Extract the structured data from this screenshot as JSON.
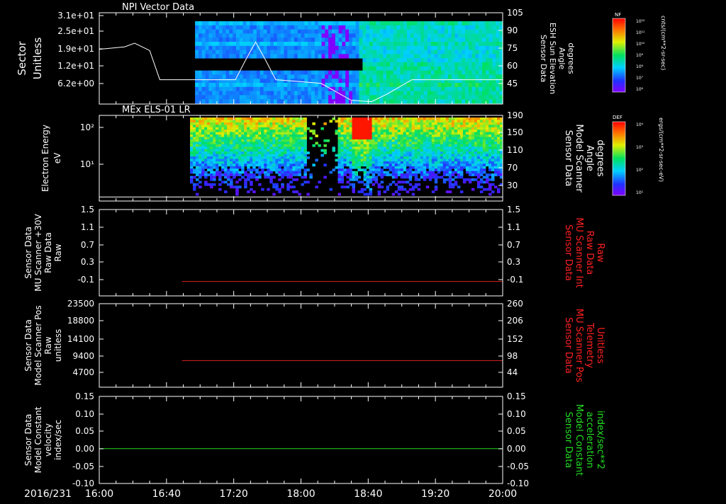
{
  "time_axis": {
    "date": "2016/231",
    "ticks": [
      "16:00",
      "16:40",
      "17:20",
      "18:00",
      "18:40",
      "19:20",
      "20:00"
    ],
    "range_hours": [
      16,
      20
    ]
  },
  "colorbars": [
    {
      "tag": "NF",
      "unit": "cnts/(cm**2-sr-sec)",
      "tick_labels": [
        "10¹²",
        "10¹¹",
        "10¹⁰",
        "10⁹",
        "10⁸",
        "10⁷",
        "10⁶"
      ]
    },
    {
      "tag": "DEF",
      "unit": "ergs/(cm**2-sr-sec-eV)",
      "tick_labels": [
        "10⁴",
        "10³",
        "10²",
        "10¹"
      ]
    }
  ],
  "chart_data": [
    {
      "type": "heatmap",
      "title": "NPI Vector Data",
      "ylabel": [
        "Sector",
        "Unitless"
      ],
      "y_ticks": [
        "3.1e+01",
        "2.5e+01",
        "1.9e+01",
        "1.2e+01",
        "6.2e+00"
      ],
      "ylabel_right": [
        "Sensor Data",
        "ESH Sun Elevation",
        "Angle",
        "degrees"
      ],
      "y_ticks_right": [
        "105",
        "90",
        "75",
        "60",
        "45"
      ],
      "ylim_right": [
        30,
        105
      ],
      "data_start_hour": 16.95,
      "overlay_line": {
        "name": "ESH Sun Elevation",
        "x_hours": [
          16.0,
          16.25,
          16.35,
          16.5,
          16.6,
          17.0,
          17.35,
          17.45,
          17.55,
          17.65,
          17.75,
          17.9,
          18.2,
          18.5,
          18.7,
          18.85,
          19.1,
          20.0
        ],
        "y_deg": [
          75,
          77,
          80,
          74,
          50,
          50,
          50,
          66,
          81,
          66,
          50,
          49,
          47,
          33,
          32,
          38,
          50,
          50
        ]
      }
    },
    {
      "type": "heatmap",
      "title": "MEx ELS-01 LR",
      "ylabel": [
        "Electron Energy",
        "eV"
      ],
      "y_ticks": [
        "10²",
        "10¹"
      ],
      "ylabel_right": [
        "Sensor Data",
        "Model Scanner",
        "Angle",
        "degrees"
      ],
      "y_ticks_right": [
        "190",
        "150",
        "110",
        "70",
        "30"
      ],
      "ylim_right": [
        0,
        190
      ],
      "data_start_hour": 16.9,
      "overlay_line": {
        "name": "Model Scanner Angle",
        "y_deg": 9
      }
    },
    {
      "type": "line",
      "ylabel": [
        "Sensor Data",
        "MU Scanner +30V",
        "Raw Data",
        "Raw"
      ],
      "y_ticks": [
        "1.5",
        "1.1",
        "0.7",
        "0.3",
        "-0.1"
      ],
      "ylim": [
        -0.3,
        1.5
      ],
      "ylabel_right": [
        "Sensor Data",
        "MU Scanner Int",
        "Raw Data",
        "Raw"
      ],
      "y_ticks_right": [
        "1.5",
        "1.1",
        "0.7",
        "0.3",
        "-0.1"
      ],
      "series": [
        {
          "name": "MU Scanner Int",
          "color": "#e02020",
          "x_start_hour": 16.82,
          "x_end_hour": 20.0,
          "value": 0.0
        }
      ]
    },
    {
      "type": "line",
      "ylabel": [
        "Sensor Data",
        "Model Scanner Pos",
        "Raw",
        "unitless"
      ],
      "y_ticks": [
        "23500",
        "18800",
        "14100",
        "9400",
        "4700"
      ],
      "ylim": [
        0,
        23500
      ],
      "ylabel_right": [
        "Sensor Data",
        "MU Scanner Pos",
        "Telemetry",
        "Unitless"
      ],
      "y_ticks_right": [
        "260",
        "206",
        "152",
        "98",
        "44"
      ],
      "ylim_right": [
        0,
        260
      ],
      "series": [
        {
          "name": "MU Scanner Pos",
          "color": "#e02020",
          "x_start_hour": 16.82,
          "x_end_hour": 20.0,
          "value_right": 83
        }
      ]
    },
    {
      "type": "line",
      "ylabel": [
        "Sensor Data",
        "Model Constant",
        "velocity",
        "index/sec"
      ],
      "y_ticks": [
        "0.15",
        "0.10",
        "0.05",
        "0.00",
        "-0.05",
        "-0.10"
      ],
      "ylim": [
        -0.1,
        0.15
      ],
      "ylabel_right": [
        "Sensor Data",
        "Model Constant",
        "acceleration",
        "index/sec**2"
      ],
      "y_ticks_right": [
        "0.15",
        "0.10",
        "0.05",
        "0.00",
        "-0.05",
        "-0.10"
      ],
      "series": [
        {
          "name": "Model Constant acceleration",
          "color": "#22dd22",
          "x_start_hour": 16.0,
          "x_end_hour": 20.0,
          "value": 0.0
        }
      ]
    }
  ]
}
